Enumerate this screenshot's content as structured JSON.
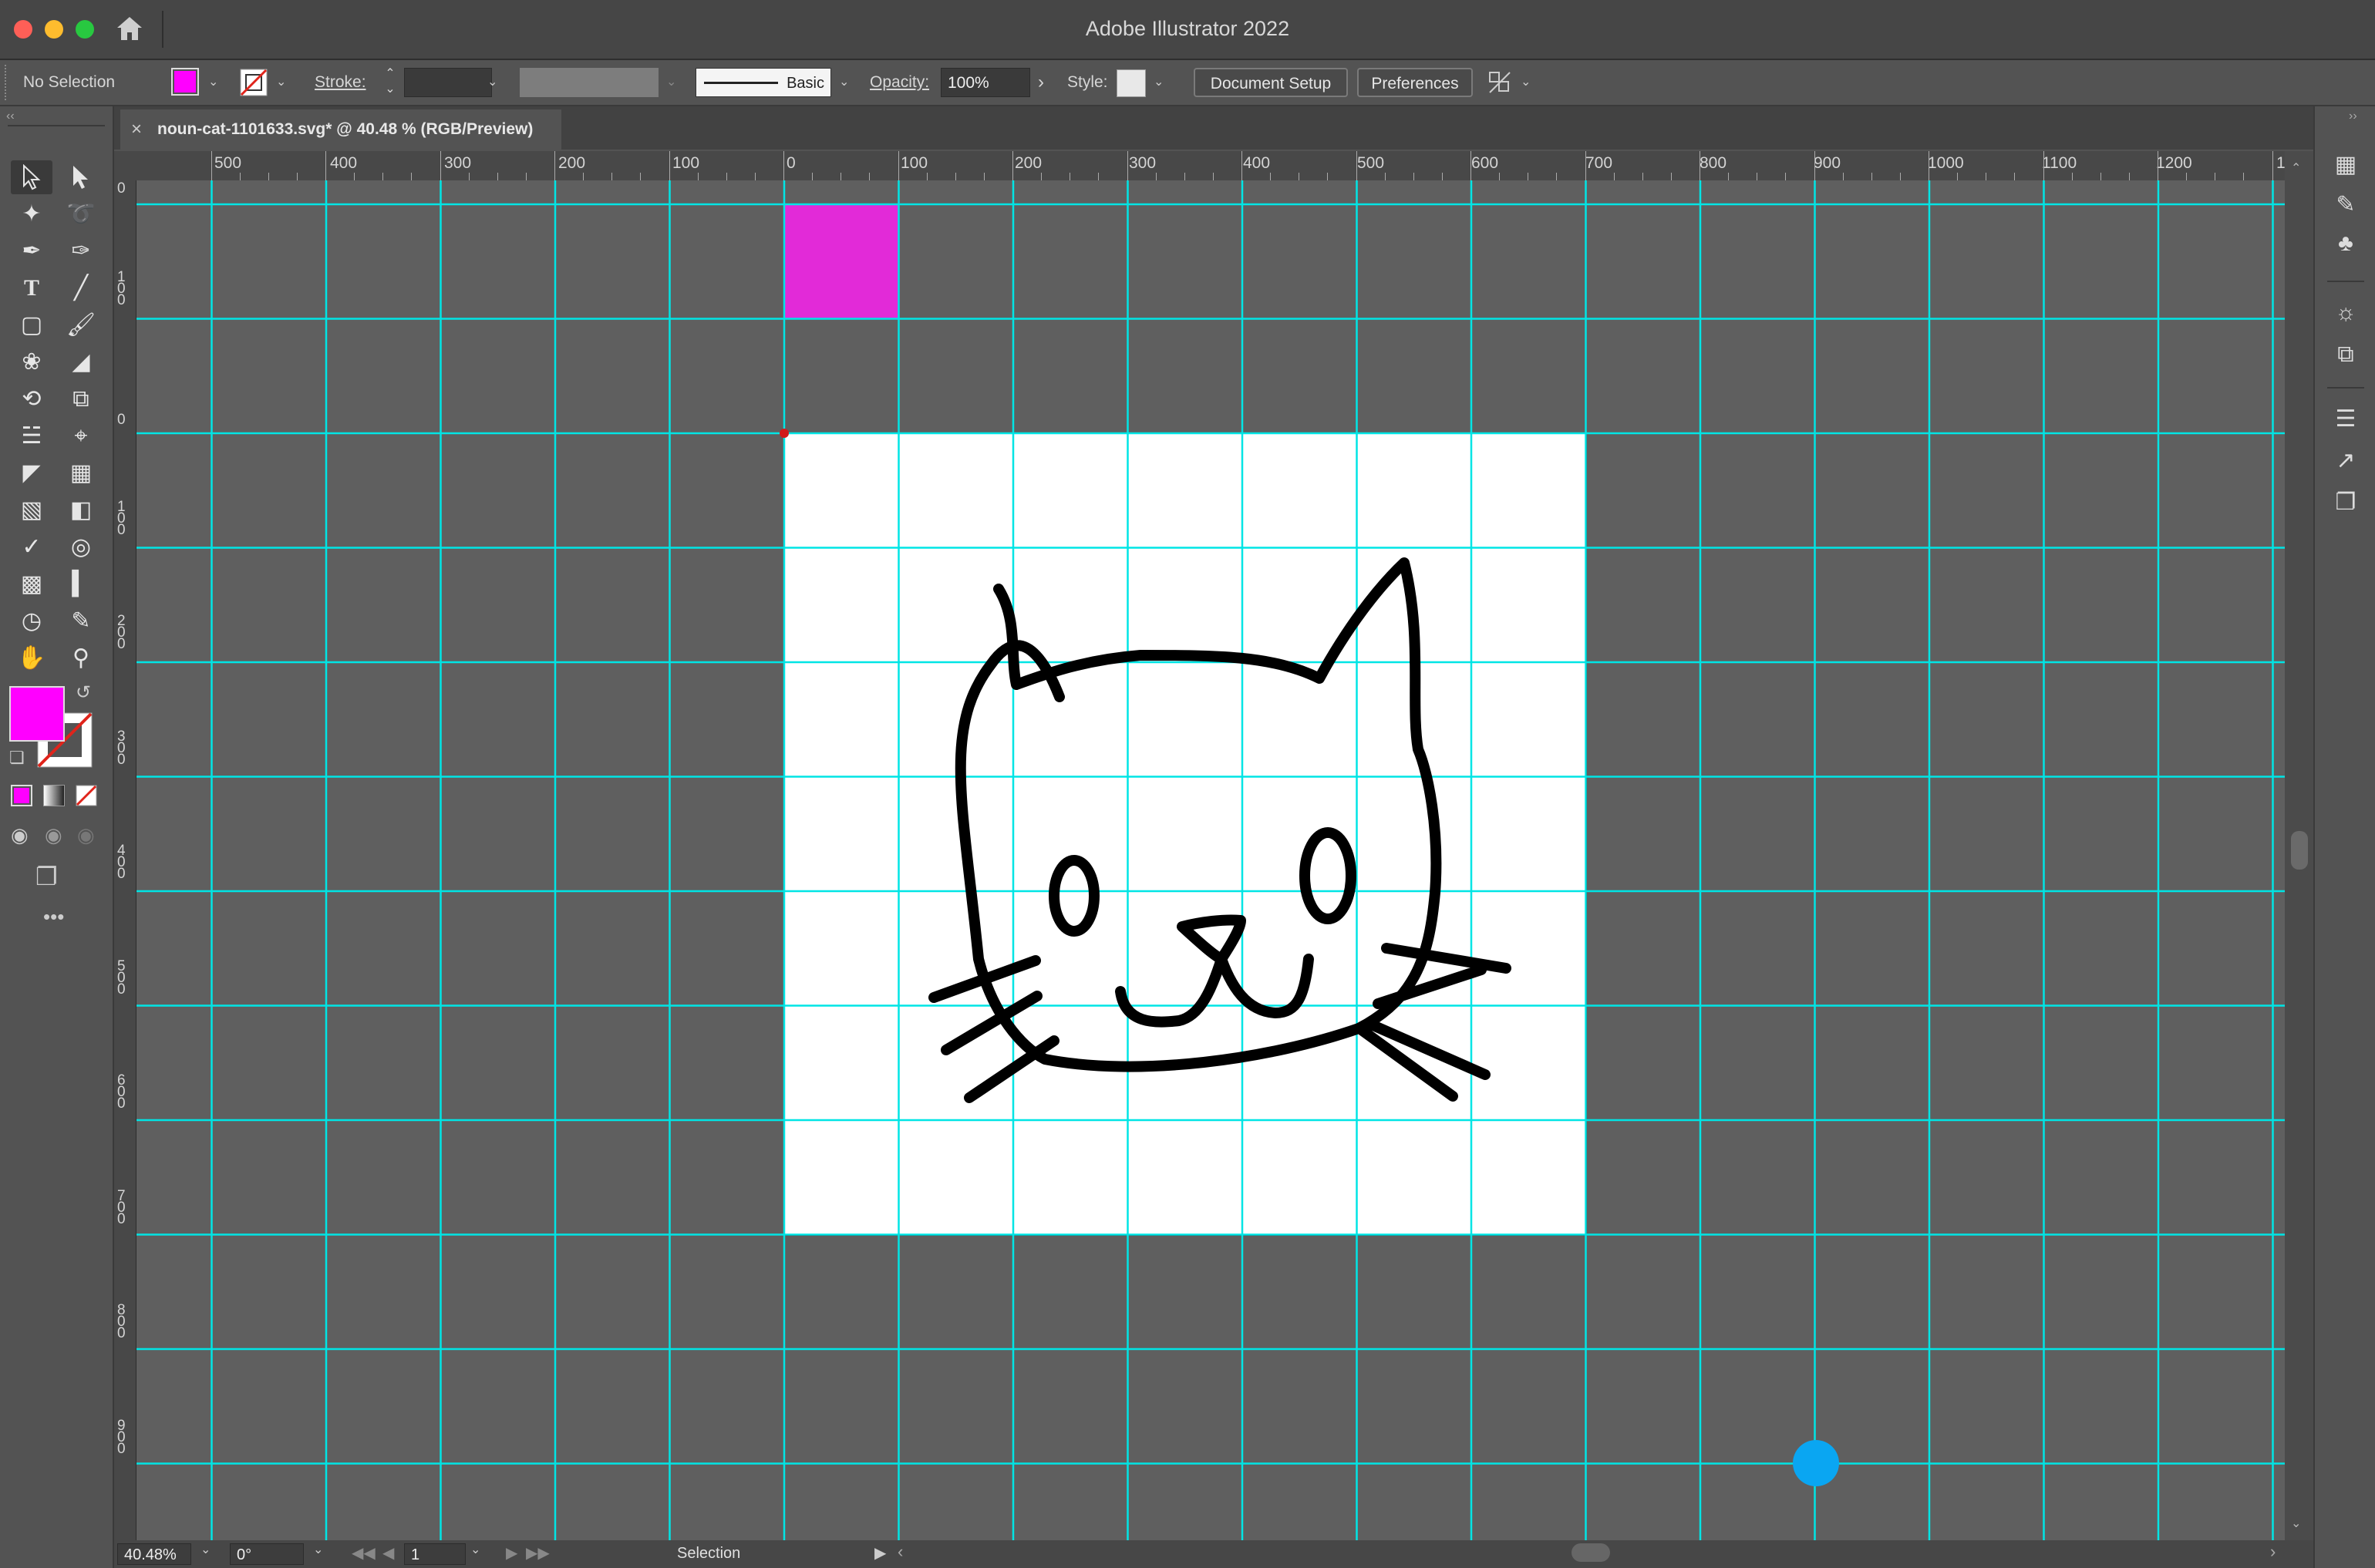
{
  "app": {
    "title": "Adobe Illustrator 2022"
  },
  "control_bar": {
    "selection_status": "No Selection",
    "fill_color": "#ff00ff",
    "stroke_label": "Stroke:",
    "stroke_weight": "",
    "brush_label": "Basic",
    "opacity_label": "Opacity:",
    "opacity_value": "100%",
    "style_label": "Style:",
    "document_setup_label": "Document Setup",
    "preferences_label": "Preferences"
  },
  "document": {
    "tab_title": "noun-cat-1101633.svg* @ 40.48 % (RGB/Preview)",
    "close_glyph": "×"
  },
  "rulers": {
    "horizontal": [
      "500",
      "400",
      "300",
      "200",
      "100",
      "0",
      "100",
      "200",
      "300",
      "400",
      "500",
      "600",
      "700",
      "800",
      "900",
      "1000",
      "1100",
      "1200",
      "1"
    ],
    "vertical": [
      "0",
      "100",
      "0",
      "100",
      "200",
      "300",
      "400",
      "500",
      "600",
      "700",
      "800",
      "900"
    ]
  },
  "toolbar": {
    "fill_color": "#ff00ff",
    "more_tools": "•••"
  },
  "status_bar": {
    "zoom": "40.48%",
    "rotation": "0°",
    "artboard_number": "1",
    "current_tool": "Selection"
  },
  "colors": {
    "guide": "#00e5e5",
    "artboard": "#ffffff",
    "pasteboard": "#5f5f5f",
    "magenta_square": "#e22ad8",
    "cursor_dot": "#0aa6f2"
  }
}
